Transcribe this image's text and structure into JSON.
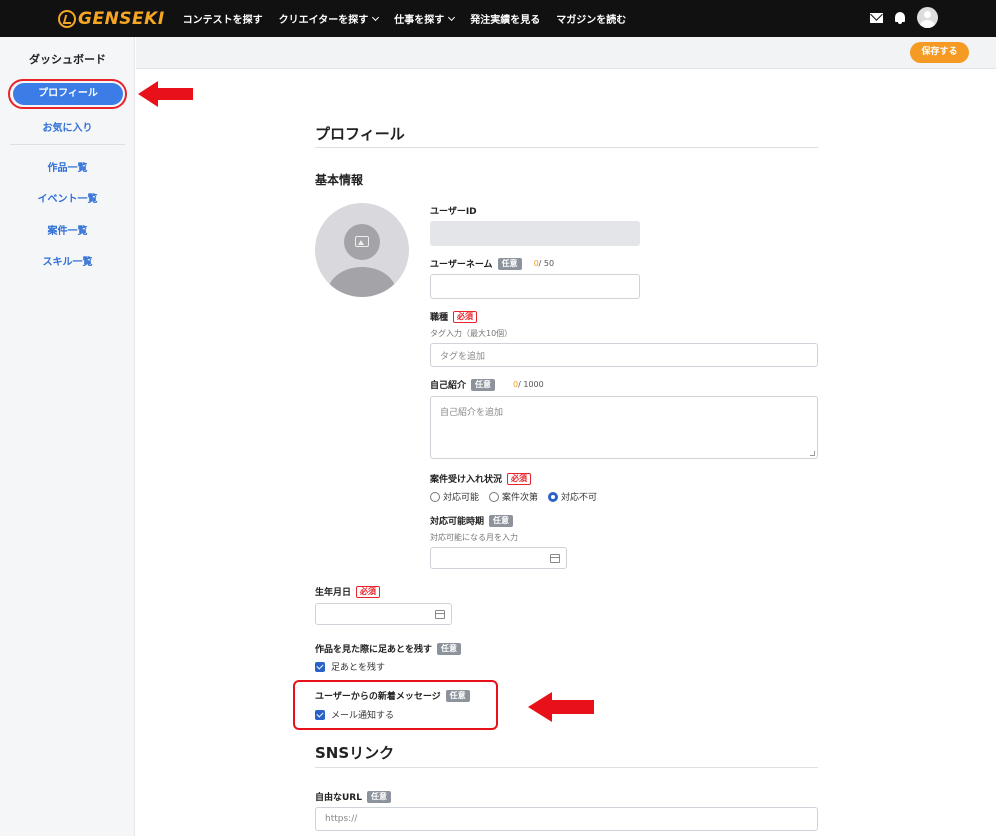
{
  "header": {
    "logo_text": "GENSEKI",
    "nav": [
      {
        "label": "コンテストを探す"
      },
      {
        "label": "クリエイターを探す"
      },
      {
        "label": "仕事を探す"
      },
      {
        "label": "発注実績を見る"
      },
      {
        "label": "マガジンを読む"
      }
    ]
  },
  "sidebar": {
    "title": "ダッシュボード",
    "active": "プロフィール",
    "items": [
      "お気に入り",
      "作品一覧",
      "イベント一覧",
      "案件一覧",
      "スキル一覧"
    ]
  },
  "toolbar": {
    "save_label": "保存する"
  },
  "main": {
    "page_title": "プロフィール",
    "section_basic": "基本情報",
    "user_id": {
      "label": "ユーザーID",
      "value": ""
    },
    "username": {
      "label": "ユーザーネーム",
      "badge": "任意",
      "count": "0",
      "max": "/ 50",
      "value": ""
    },
    "occupation": {
      "label": "職種",
      "badge": "必須",
      "hint": "タグ入力（最大10個）",
      "placeholder": "タグを追加"
    },
    "bio": {
      "label": "自己紹介",
      "badge": "任意",
      "count": "0",
      "max": "/ 1000",
      "placeholder": "自己紹介を追加"
    },
    "availability": {
      "label": "案件受け入れ状況",
      "badge": "必須",
      "options": [
        "対応可能",
        "案件次第",
        "対応不可"
      ],
      "selected": "対応不可"
    },
    "available_period": {
      "label": "対応可能時期",
      "badge": "任意",
      "hint": "対応可能になる月を入力",
      "value": ""
    },
    "birthday": {
      "label": "生年月日",
      "badge": "必須",
      "value": ""
    },
    "footprint": {
      "label": "作品を見た際に足あとを残す",
      "badge": "任意",
      "checkbox_label": "足あとを残す",
      "checked": true
    },
    "messages": {
      "label": "ユーザーからの新着メッセージ",
      "badge": "任意",
      "checkbox_label": "メール通知する",
      "checked": true
    },
    "sns_title": "SNSリンク",
    "free_url": {
      "label": "自由なURL",
      "badge": "任意",
      "placeholder": "https://"
    }
  },
  "colors": {
    "accent": "#f59a23",
    "primary": "#3b7ce6",
    "annotation_red": "#e8111a"
  }
}
